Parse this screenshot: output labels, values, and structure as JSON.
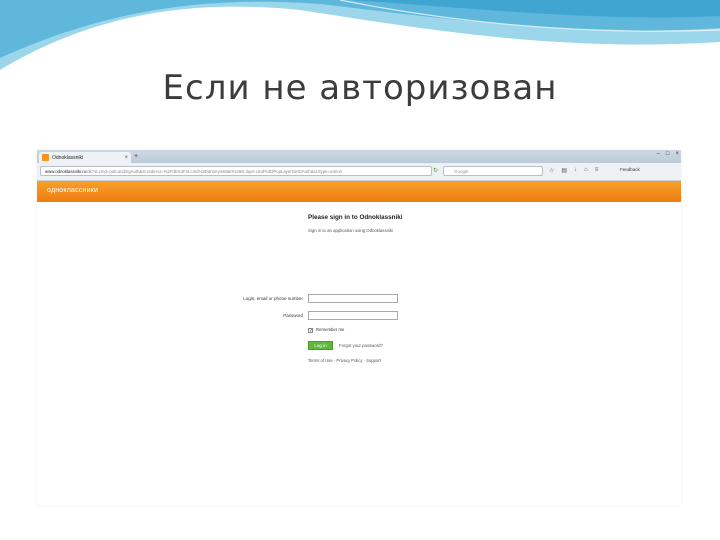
{
  "slide": {
    "title": "Если не авторизован"
  },
  "browser": {
    "tab_title": "Odnoklassniki",
    "tab_close": "×",
    "new_tab": "+",
    "window_controls": [
      "–",
      "□",
      "×"
    ],
    "url_host": "www.odnoklassniki.ru",
    "url_rest": "/dk?st.cmd=outLandingAuth&st.redirect=%2Fdk%3Fst.cmd%3DanonymMain%26st.layer.cmd%3DPopLayerGetOAuth&st.ttype=uanon",
    "search_placeholder": "Google",
    "feedback_label": "Feedback",
    "icon_names": [
      "back-icon",
      "search-icon",
      "star-icon",
      "home-icon",
      "download-icon",
      "menu-icon"
    ]
  },
  "site": {
    "logo_text": "одноклассники",
    "brand_color": "#ee7d10"
  },
  "login": {
    "heading": "Please sign in to Odnoklassniki",
    "subtext": "Sign in to an application using Odnoklassniki",
    "login_label": "Login, email or phone number",
    "password_label": "Password",
    "remember_label": "Remember me",
    "remember_checked": true,
    "login_button": "Log in",
    "forgot_link": "Forgot your password?",
    "terms": "Terms of Use · Privacy Policy · Support"
  }
}
